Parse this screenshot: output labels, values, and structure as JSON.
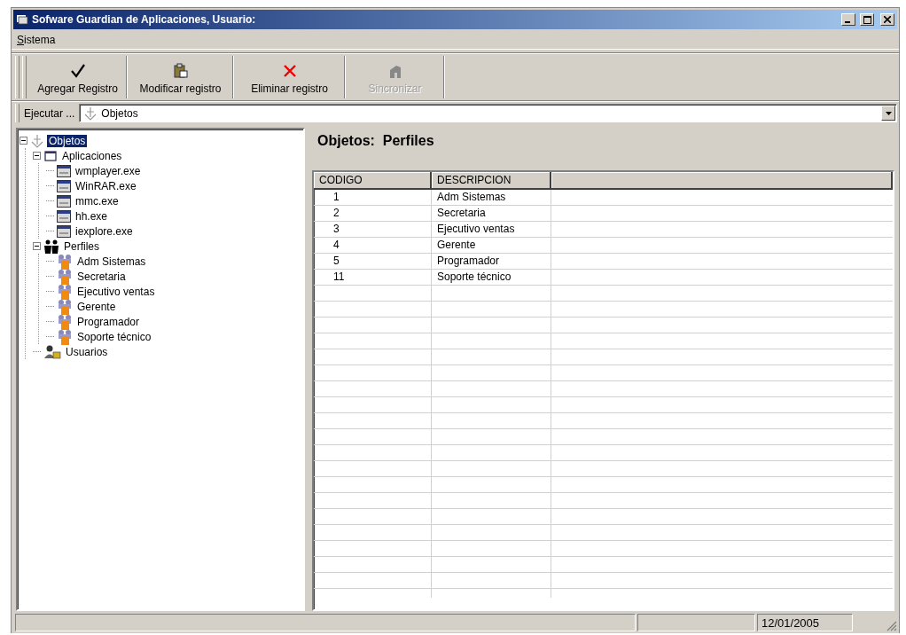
{
  "window": {
    "title": "Sofware Guardian de Aplicaciones, Usuario:"
  },
  "menu": [
    "Sistema"
  ],
  "toolbar": [
    {
      "kind": "check",
      "label": "Agregar Registro",
      "disabled": false
    },
    {
      "kind": "paste",
      "label": "Modificar registro",
      "disabled": false
    },
    {
      "kind": "delete",
      "label": "Eliminar registro",
      "disabled": false
    },
    {
      "kind": "sync",
      "label": "Sincronizar",
      "disabled": true
    }
  ],
  "execute_bar": {
    "label": "Ejecutar ...",
    "value": "Objetos"
  },
  "tree": [
    {
      "kind": "root",
      "label": "Objetos",
      "selected": true,
      "expanded": true,
      "children": [
        {
          "kind": "apps",
          "label": "Aplicaciones",
          "selected": false,
          "expanded": true,
          "children": [
            {
              "kind": "app",
              "label": "wmplayer.exe",
              "selected": false
            },
            {
              "kind": "app",
              "label": "WinRAR.exe",
              "selected": false
            },
            {
              "kind": "app",
              "label": "mmc.exe",
              "selected": false
            },
            {
              "kind": "app",
              "label": "hh.exe",
              "selected": false
            },
            {
              "kind": "app",
              "label": "iexplore.exe",
              "selected": false
            }
          ]
        },
        {
          "kind": "profiles",
          "label": "Perfiles",
          "selected": false,
          "expanded": true,
          "children": [
            {
              "kind": "profile",
              "label": "Adm Sistemas",
              "selected": false
            },
            {
              "kind": "profile",
              "label": "Secretaria",
              "selected": false
            },
            {
              "kind": "profile",
              "label": "Ejecutivo ventas",
              "selected": false
            },
            {
              "kind": "profile",
              "label": "Gerente",
              "selected": false
            },
            {
              "kind": "profile",
              "label": "Programador",
              "selected": false
            },
            {
              "kind": "profile",
              "label": "Soporte técnico",
              "selected": false
            }
          ]
        },
        {
          "kind": "users",
          "label": "Usuarios",
          "selected": false
        }
      ]
    }
  ],
  "panel": {
    "title": "Objetos:  Perfiles"
  },
  "table": {
    "columns": [
      "CODIGO",
      "DESCRIPCION"
    ],
    "rows": [
      [
        "1",
        "Adm Sistemas"
      ],
      [
        "2",
        "Secretaria"
      ],
      [
        "3",
        "Ejecutivo ventas"
      ],
      [
        "4",
        "Gerente"
      ],
      [
        "5",
        "Programador"
      ],
      [
        "11",
        "Soporte técnico"
      ]
    ]
  },
  "status_bar": {
    "date": "12/01/2005"
  }
}
